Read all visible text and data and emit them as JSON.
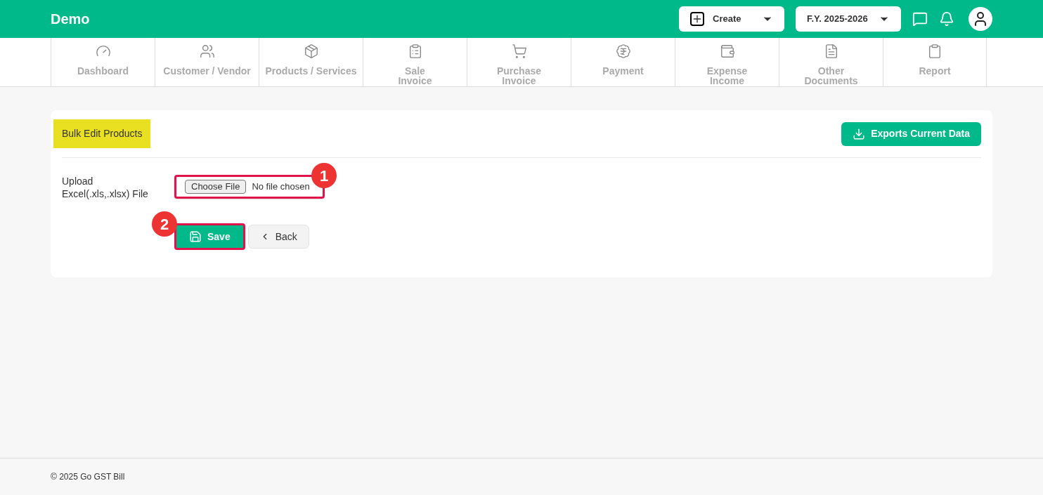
{
  "brand": "Demo",
  "header": {
    "create_label": "Create",
    "fy_label": "F.Y. 2025-2026"
  },
  "nav": [
    {
      "label": "Dashboard"
    },
    {
      "label": "Customer / Vendor"
    },
    {
      "label": "Products / Services"
    },
    {
      "label": "Sale\nInvoice"
    },
    {
      "label": "Purchase\nInvoice"
    },
    {
      "label": "Payment"
    },
    {
      "label": "Expense\nIncome"
    },
    {
      "label": "Other\nDocuments"
    },
    {
      "label": "Report"
    }
  ],
  "card": {
    "title": "Bulk Edit Products",
    "export_label": "Exports Current Data",
    "upload_label": "Upload Excel(.xls,.xlsx) File",
    "choose_file": "Choose File",
    "no_file": "No file chosen",
    "save_label": "Save",
    "back_label": "Back",
    "markers": [
      "1",
      "2"
    ]
  },
  "footer": "© 2025 Go GST Bill"
}
